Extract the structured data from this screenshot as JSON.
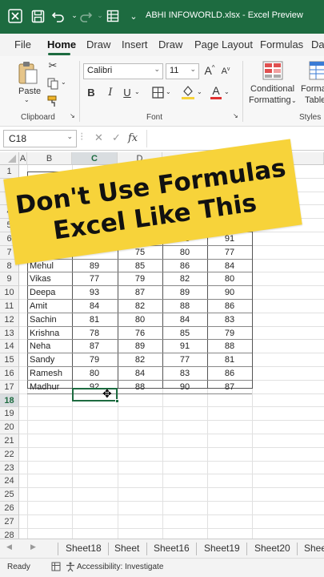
{
  "window": {
    "title": "ABHI INFOWORLD.xlsx  -  Excel Preview",
    "accent_color": "#1d6b40"
  },
  "menu": [
    "File",
    "Home",
    "Draw",
    "Insert",
    "Draw",
    "Page Layout",
    "Formulas",
    "Da"
  ],
  "menu_active": "Home",
  "ribbon": {
    "paste_label": "Paste",
    "clipboard_label": "Clipboard",
    "font_name": "Calibri",
    "font_size": "11",
    "font_label": "Font",
    "bold": "B",
    "italic": "I",
    "underline": "U",
    "grow_font": "A",
    "shrink_font": "A",
    "conditional_formatting_line1": "Conditional",
    "conditional_formatting_line2": "Formatting",
    "format_table_line1": "Forma",
    "format_table_line2": "Table",
    "styles_label": "Styles",
    "highlight_color": "#f7d33a",
    "font_color": "#e03030"
  },
  "formula_bar": {
    "name_box": "C18",
    "fx": "fx",
    "formula": ""
  },
  "grid": {
    "columns": [
      "A",
      "B",
      "C",
      "D",
      "E",
      "F",
      "G"
    ],
    "selected_column": "C",
    "rows": [
      "1",
      "2",
      "3",
      "4",
      "5",
      "6",
      "7",
      "8",
      "9",
      "10",
      "11",
      "12",
      "13",
      "14",
      "15",
      "16",
      "17",
      "18",
      "19",
      "20",
      "21",
      "22",
      "23",
      "24",
      "25",
      "26",
      "27",
      "28"
    ],
    "selected_row": "18",
    "data": [
      {
        "row": 5,
        "name": "",
        "c": "",
        "d": "",
        "e": "",
        "f": "85"
      },
      {
        "row": 6,
        "name": "Priya",
        "c": "",
        "d": "",
        "e": "83",
        "f": "91"
      },
      {
        "row": 7,
        "name": "Rajee",
        "c": "",
        "d": "75",
        "e": "80",
        "f": "77"
      },
      {
        "row": 8,
        "name": "Mehul",
        "c": "89",
        "d": "85",
        "e": "86",
        "f": "84"
      },
      {
        "row": 9,
        "name": "Vikas",
        "c": "77",
        "d": "79",
        "e": "82",
        "f": "80"
      },
      {
        "row": 10,
        "name": "Deepa",
        "c": "93",
        "d": "87",
        "e": "89",
        "f": "90"
      },
      {
        "row": 11,
        "name": "Amit",
        "c": "84",
        "d": "82",
        "e": "88",
        "f": "86"
      },
      {
        "row": 12,
        "name": "Sachin",
        "c": "81",
        "d": "80",
        "e": "84",
        "f": "83"
      },
      {
        "row": 13,
        "name": "Krishna",
        "c": "78",
        "d": "76",
        "e": "85",
        "f": "79"
      },
      {
        "row": 14,
        "name": "Neha",
        "c": "87",
        "d": "89",
        "e": "91",
        "f": "88"
      },
      {
        "row": 15,
        "name": "Sandy",
        "c": "79",
        "d": "82",
        "e": "77",
        "f": "81"
      },
      {
        "row": 16,
        "name": "Ramesh",
        "c": "80",
        "d": "84",
        "e": "83",
        "f": "86"
      },
      {
        "row": 17,
        "name": "Madhur",
        "c": "92",
        "d": "88",
        "e": "90",
        "f": "87"
      }
    ]
  },
  "banner": {
    "line1": "Don't Use Formulas",
    "line2": "Excel Like This",
    "color": "#f7d33a"
  },
  "sheets": [
    "Sheet18",
    "Sheet",
    "Sheet16",
    "Sheet19",
    "Sheet20",
    "Shee"
  ],
  "status": {
    "ready": "Ready",
    "accessibility": "Accessibility: Investigate"
  }
}
